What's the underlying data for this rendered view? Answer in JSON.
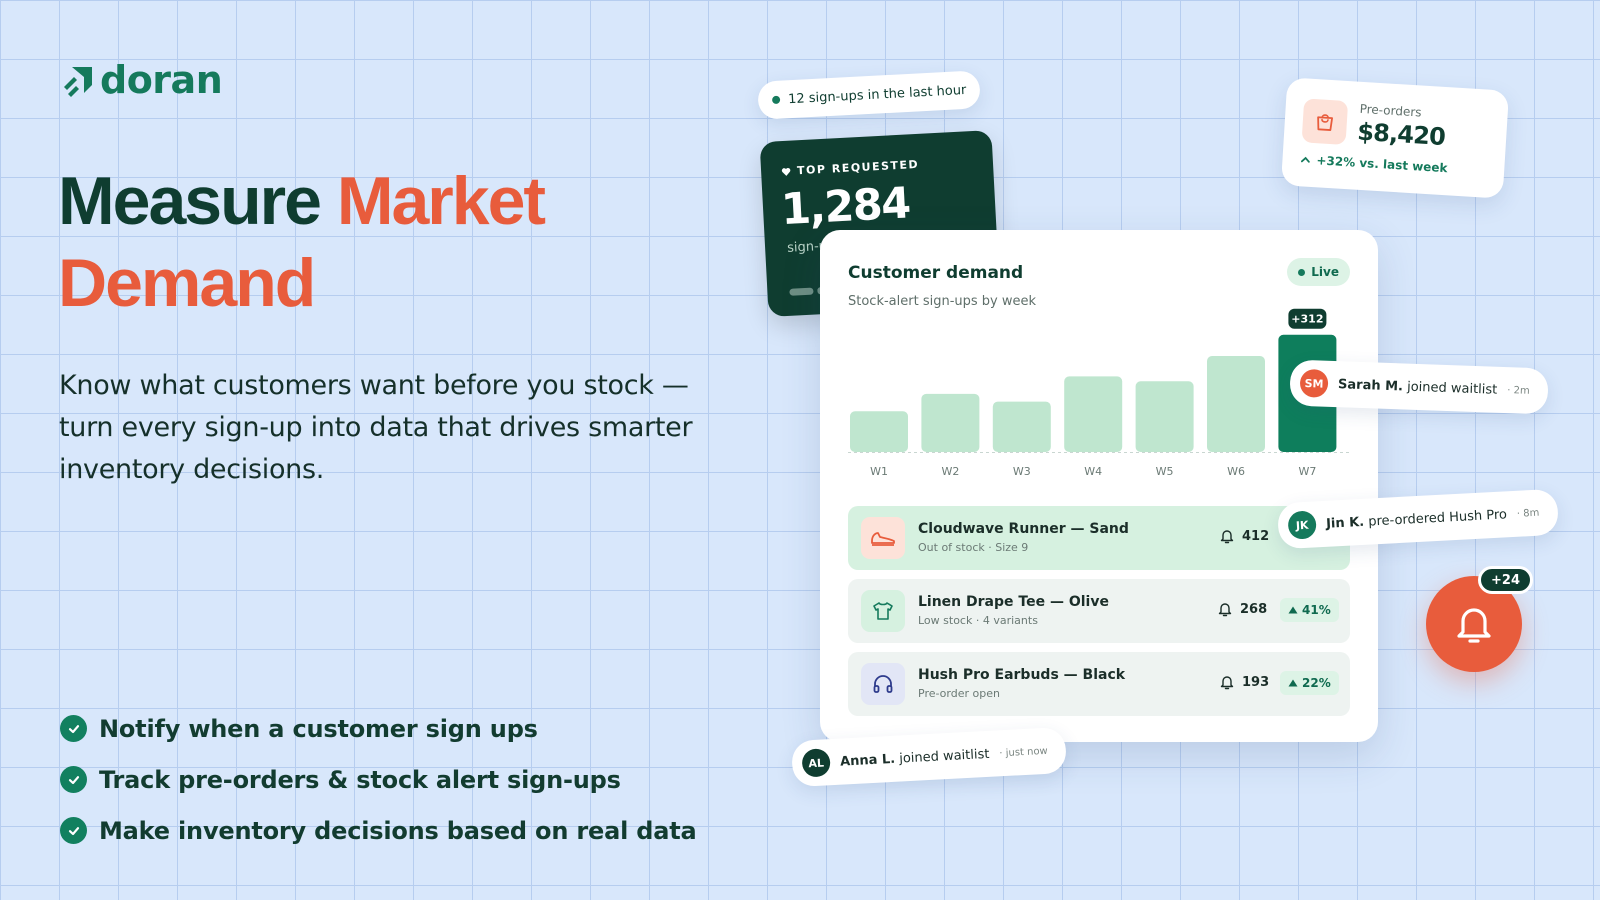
{
  "brand": {
    "name": "doran",
    "accent": "#157a5c",
    "orange": "#e85c3c",
    "dark": "#0f3d30"
  },
  "hero": {
    "title_part1": "Measure",
    "title_part2": "Market",
    "title_part3": "Demand",
    "subtitle": "Know what customers want before you stock — turn every sign-up into data that drives smarter inventory decisions."
  },
  "features": [
    "Notify when a customer sign ups",
    "Track pre-orders & stock alert sign-ups",
    "Make inventory decisions based on real data"
  ],
  "activity_pill": "12 sign-ups in the last hour",
  "top_requested": {
    "label": "TOP REQUESTED",
    "value": "1,284",
    "sub": "sign-u"
  },
  "preorders": {
    "label": "Pre-orders",
    "value": "$8,420",
    "trend": "+32% vs. last week"
  },
  "demand_card": {
    "title": "Customer demand",
    "subtitle": "Stock-alert sign-ups by week",
    "live_label": "Live",
    "highlight_label": "+312"
  },
  "chart_data": {
    "type": "bar",
    "title": "Customer demand",
    "subtitle": "Stock-alert sign-ups by week",
    "categories": [
      "W1",
      "W2",
      "W3",
      "W4",
      "W5",
      "W6",
      "W7"
    ],
    "values": [
      42,
      60,
      52,
      78,
      73,
      99,
      121
    ],
    "ylim": [
      0,
      130
    ],
    "annotations": [
      {
        "x": "W7",
        "text": "+312"
      }
    ],
    "grid": false
  },
  "products": [
    {
      "name": "Cloudwave Runner — Sand",
      "meta": "Out of stock · Size 9",
      "count": "412",
      "badge": "",
      "icon": "shoe-icon"
    },
    {
      "name": "Linen Drape Tee — Olive",
      "meta": "Low stock · 4 variants",
      "count": "268",
      "badge": "41%",
      "icon": "shirt-icon"
    },
    {
      "name": "Hush Pro Earbuds — Black",
      "meta": "Pre-order open",
      "count": "193",
      "badge": "22%",
      "icon": "headphones-icon"
    }
  ],
  "notifications": [
    {
      "initials": "SM",
      "name": "Sarah M.",
      "action": "joined waitlist",
      "ago": "· 2m",
      "color": "#e85c3c"
    },
    {
      "initials": "JK",
      "name": "Jin K.",
      "action": "pre-ordered Hush Pro",
      "ago": "· 8m",
      "color": "#157a5c"
    },
    {
      "initials": "AL",
      "name": "Anna L.",
      "action": "joined waitlist",
      "ago": "· just now",
      "color": "#0f3d30"
    }
  ],
  "bell_badge": "+24"
}
